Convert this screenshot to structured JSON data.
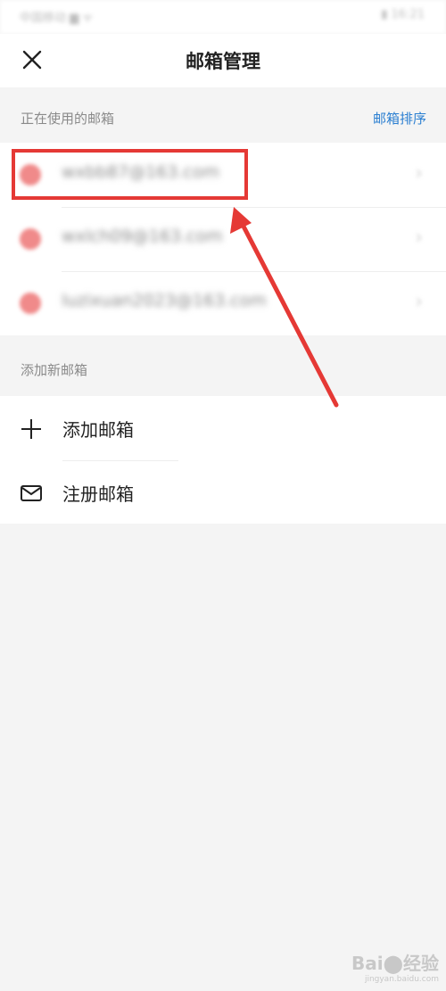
{
  "status_bar": {
    "left_text": "中国移动 ▆ ᯤ",
    "right_text": "▮ 16:21"
  },
  "nav": {
    "title": "邮箱管理",
    "close_icon": "close-icon"
  },
  "in_use_section": {
    "label": "正在使用的邮箱",
    "action_label": "邮箱排序"
  },
  "accounts": [
    {
      "address": "wxbb87@163.com",
      "chevron": "›"
    },
    {
      "address": "wxlch09@163.com",
      "chevron": "›"
    },
    {
      "address": "luzixuan2023@163.com",
      "chevron": "›"
    }
  ],
  "add_section": {
    "label": "添加新邮箱"
  },
  "actions": [
    {
      "label": "添加邮箱",
      "icon": "plus-icon"
    },
    {
      "label": "注册邮箱",
      "icon": "mail-icon"
    }
  ],
  "annotation": {
    "color": "#e53935"
  },
  "watermark": {
    "text": "Bai⬤经验",
    "sub": "jingyan.baidu.com"
  },
  "colors": {
    "link": "#2b7fd1",
    "background": "#f4f4f4",
    "avatar": "#f08a8a"
  }
}
